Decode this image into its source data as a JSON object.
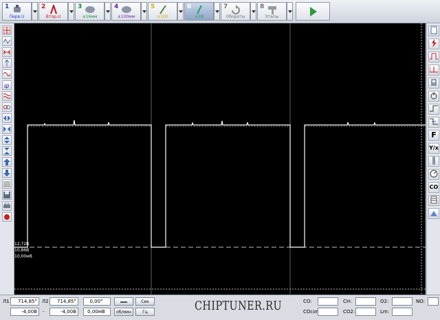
{
  "channels": [
    {
      "num": "1",
      "label": "Перв.U",
      "color": "#1a3fc4"
    },
    {
      "num": "2",
      "label": "Втор.U",
      "color": "#c8141e"
    },
    {
      "num": "3",
      "label": "±16мм",
      "color": "#0e8a2c"
    },
    {
      "num": "4",
      "label": "±100мм",
      "color": "#6a1fa8"
    },
    {
      "num": "5",
      "label": "±100",
      "color": "#c8b000"
    },
    {
      "num": "6",
      "label": "±5В",
      "color": "#2a9a7a"
    },
    {
      "num": "7",
      "label": "Обороты",
      "color": "#707070"
    },
    {
      "num": "8",
      "label": "Этапы",
      "color": "#707070"
    }
  ],
  "scope": {
    "scale_labels": [
      "12,72В",
      "10,86В",
      "10,00мВ"
    ],
    "signal_color": "#ffffff",
    "background": "#000000"
  },
  "cursors": {
    "l1_label": "Л1",
    "l1_value": "714,85°",
    "l2_label": "Л2",
    "l2_value": "714,85°",
    "delta_value": "0,00°",
    "sec_label": "Сек",
    "v1": "-4,00В",
    "dash": "-",
    "v2": "-4,00В",
    "dv": "0,00мВ",
    "mode_label": "об/мин",
    "hz_label": "Гц"
  },
  "watermark": "CHIPTUNER.RU",
  "gas": {
    "co": "CO:",
    "ch": "CH:",
    "o2": "O2:",
    "no": "NO:",
    "cocor": "COcor:",
    "co2": "CO2:",
    "lambda": "Lm:"
  }
}
